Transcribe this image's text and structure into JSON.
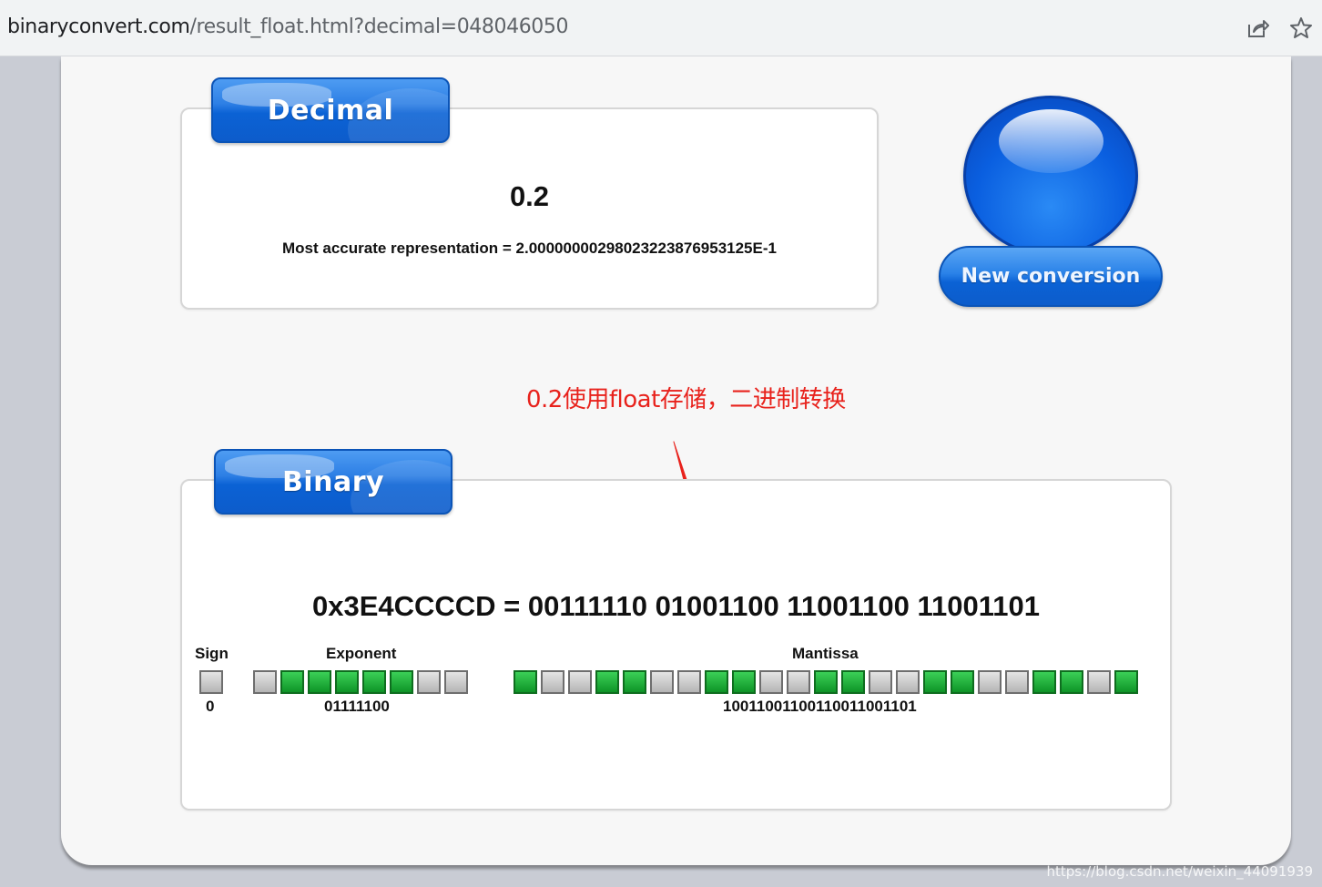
{
  "browser": {
    "url_host": "binaryconvert.com",
    "url_path": "/result_float.html?decimal=048046050",
    "share_icon": "share-icon",
    "bookmark_icon": "star-icon"
  },
  "decimal_panel": {
    "tab_label": "Decimal",
    "value": "0.2",
    "accurate_text": "Most accurate representation = 2.00000000298023223876953125E-1"
  },
  "new_conversion": {
    "label": "New conversion"
  },
  "annotation": {
    "text": "0.2使用float存储，二进制转换"
  },
  "binary_panel": {
    "tab_label": "Binary",
    "hex_line": "0x3E4CCCCD = 00111110 01001100 11001100 11001101",
    "sign": {
      "label": "Sign",
      "value": "0",
      "bits": [
        0
      ]
    },
    "exponent": {
      "label": "Exponent",
      "value": "01111100",
      "bits": [
        0,
        1,
        1,
        1,
        1,
        1,
        0,
        0
      ]
    },
    "mantissa": {
      "label": "Mantissa",
      "value": "10011001100110011001101",
      "bits": [
        1,
        0,
        0,
        1,
        1,
        0,
        0,
        1,
        1,
        0,
        0,
        1,
        1,
        0,
        0,
        1,
        1,
        0,
        0,
        1,
        1,
        0,
        1
      ]
    }
  },
  "watermark": {
    "text": "https://blog.csdn.net/weixin_44091939"
  },
  "colors": {
    "bit_on": "#16a52e",
    "bit_off": "#c8c8c8",
    "accent_blue": "#0b62d5",
    "annotation_red": "#e8221c"
  }
}
